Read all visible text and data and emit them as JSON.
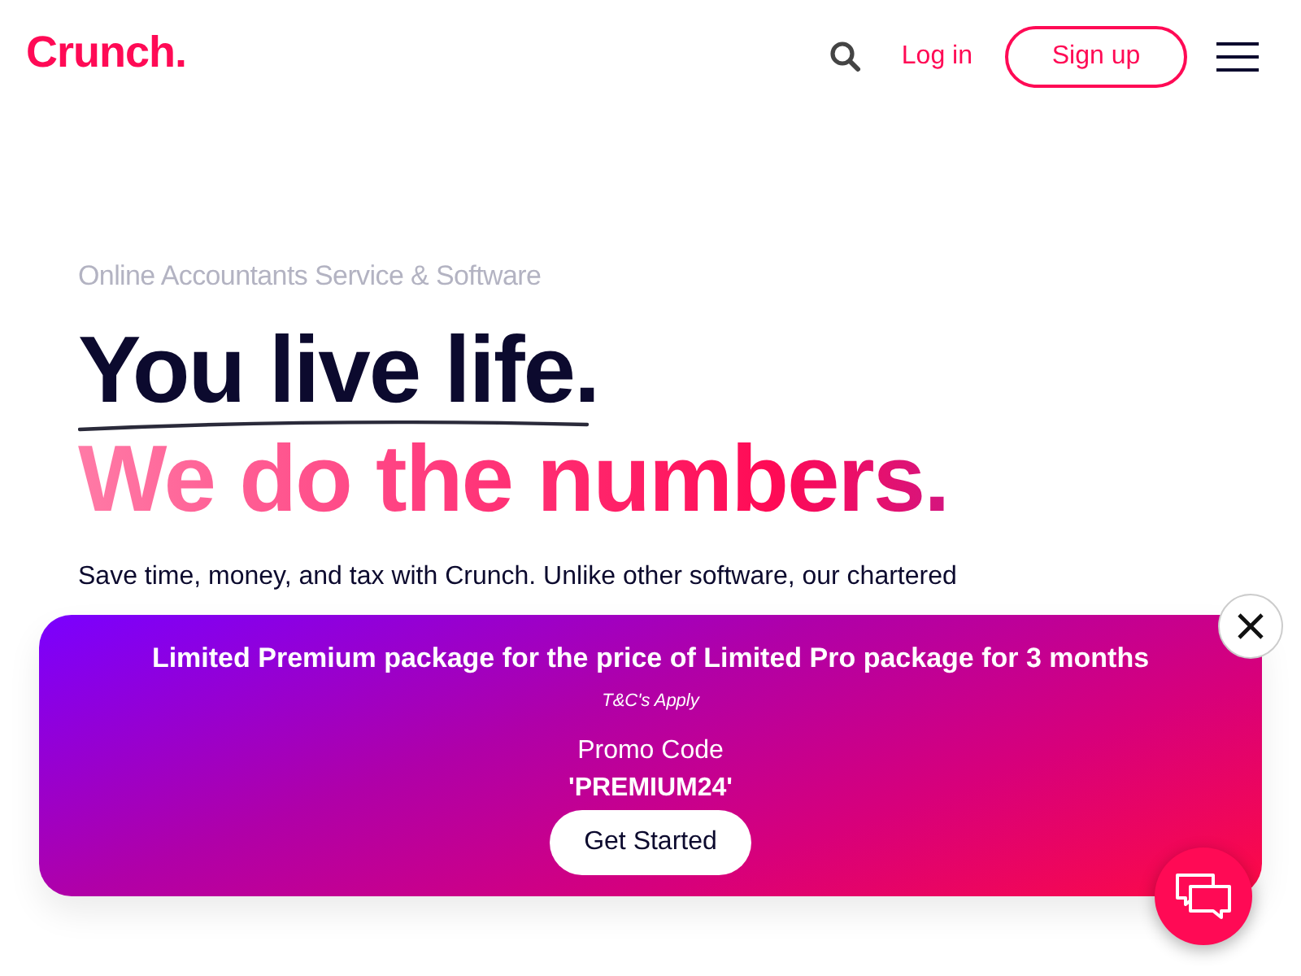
{
  "header": {
    "logo": "Crunch.",
    "login": "Log in",
    "signup": "Sign up"
  },
  "hero": {
    "eyebrow": "Online Accountants Service & Software",
    "headline_1": "You live life.",
    "headline_2": "We do the numbers.",
    "intro": "Save time, money, and tax with Crunch. Unlike other software, our chartered"
  },
  "promo": {
    "title": "Limited Premium package for the price of Limited Pro package for 3 months",
    "terms": "T&C's Apply",
    "code_label": "Promo Code",
    "code": "'PREMIUM24'",
    "button": "Get Started"
  }
}
